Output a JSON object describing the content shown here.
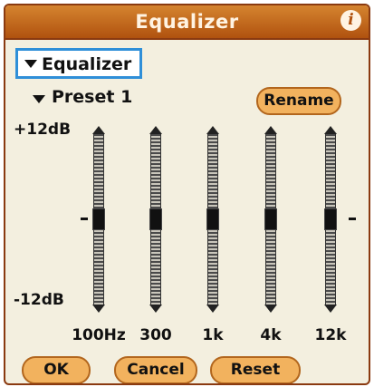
{
  "title": "Equalizer",
  "mode_dropdown": {
    "value": "Equalizer"
  },
  "preset_dropdown": {
    "value": "Preset 1"
  },
  "rename_button": "Rename",
  "db_scale": {
    "top": "+12dB",
    "bottom": "-12dB"
  },
  "bands": [
    {
      "freq": "100Hz",
      "gain_db": 0
    },
    {
      "freq": "300",
      "gain_db": 0
    },
    {
      "freq": "1k",
      "gain_db": 0
    },
    {
      "freq": "4k",
      "gain_db": 0
    },
    {
      "freq": "12k",
      "gain_db": 0
    }
  ],
  "buttons": {
    "ok": "OK",
    "cancel": "Cancel",
    "reset": "Reset"
  },
  "colors": {
    "title_bar": "#b0520f",
    "button_fill": "#f2b25e",
    "focus_border": "#2f8fd8",
    "background": "#f3efdf"
  },
  "icons": {
    "info": "info-icon",
    "dropdown": "triangle-down-icon"
  }
}
